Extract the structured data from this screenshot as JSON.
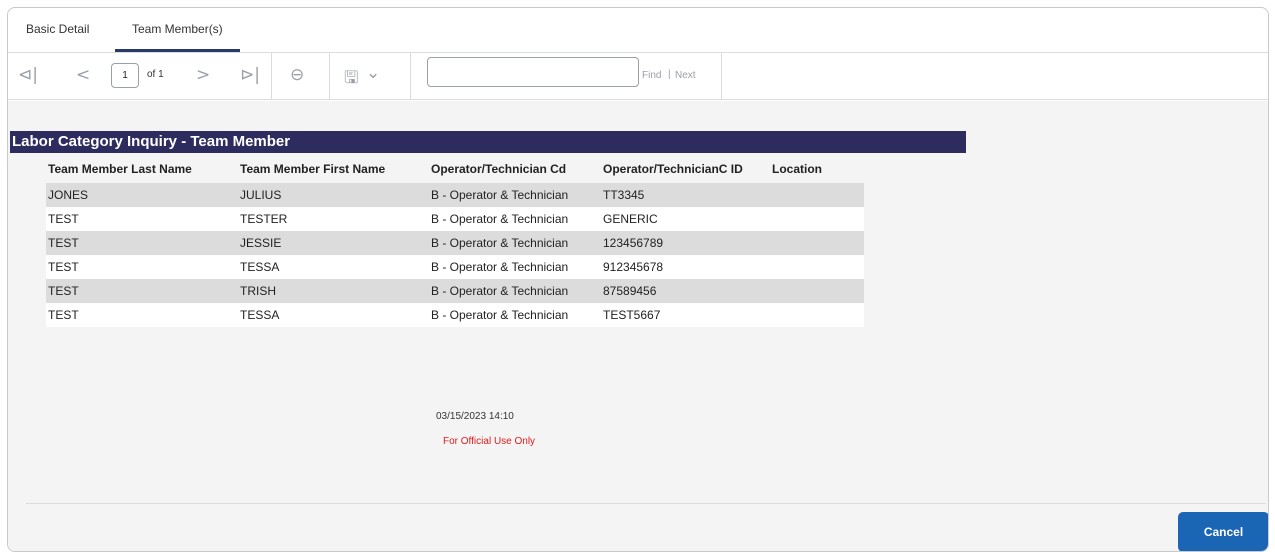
{
  "tabs": [
    {
      "label": "Basic Detail"
    },
    {
      "label": "Team Member(s)"
    }
  ],
  "toolbar": {
    "first_icon": "⊲|",
    "prev_icon": "<",
    "page_value": "1",
    "of_label": "of 1",
    "next_icon": ">",
    "last_icon": "⊳|",
    "back_icon": "⊖",
    "save_icon": "🖫",
    "dropdown_icon": "⌄",
    "find_label": "Find",
    "pipe": "|",
    "next_label": "Next",
    "search_value": ""
  },
  "report": {
    "title": "Labor Category Inquiry - Team Member",
    "columns": [
      "Team Member Last Name",
      "Team Member First Name",
      "Operator/Technician Cd",
      "Operator/TechnicianC ID",
      "Location"
    ],
    "rows": [
      [
        "JONES",
        "JULIUS",
        "B - Operator & Technician",
        "TT3345",
        ""
      ],
      [
        "TEST",
        "TESTER",
        "B - Operator & Technician",
        "GENERIC",
        ""
      ],
      [
        "TEST",
        "JESSIE",
        "B - Operator & Technician",
        "123456789",
        ""
      ],
      [
        "TEST",
        "TESSA",
        "B - Operator & Technician",
        "912345678",
        ""
      ],
      [
        "TEST",
        "TRISH",
        "B - Operator & Technician",
        "87589456",
        ""
      ],
      [
        "TEST",
        "TESSA",
        "B - Operator & Technician",
        "TEST5667",
        ""
      ]
    ],
    "timestamp": "03/15/2023 14:10",
    "classification": "For Official Use Only"
  },
  "footer": {
    "cancel_label": "Cancel"
  },
  "colors": {
    "title_bar": "#2e2b5f",
    "cancel_button": "#1b65b5",
    "classification_text": "#e01b1b"
  }
}
